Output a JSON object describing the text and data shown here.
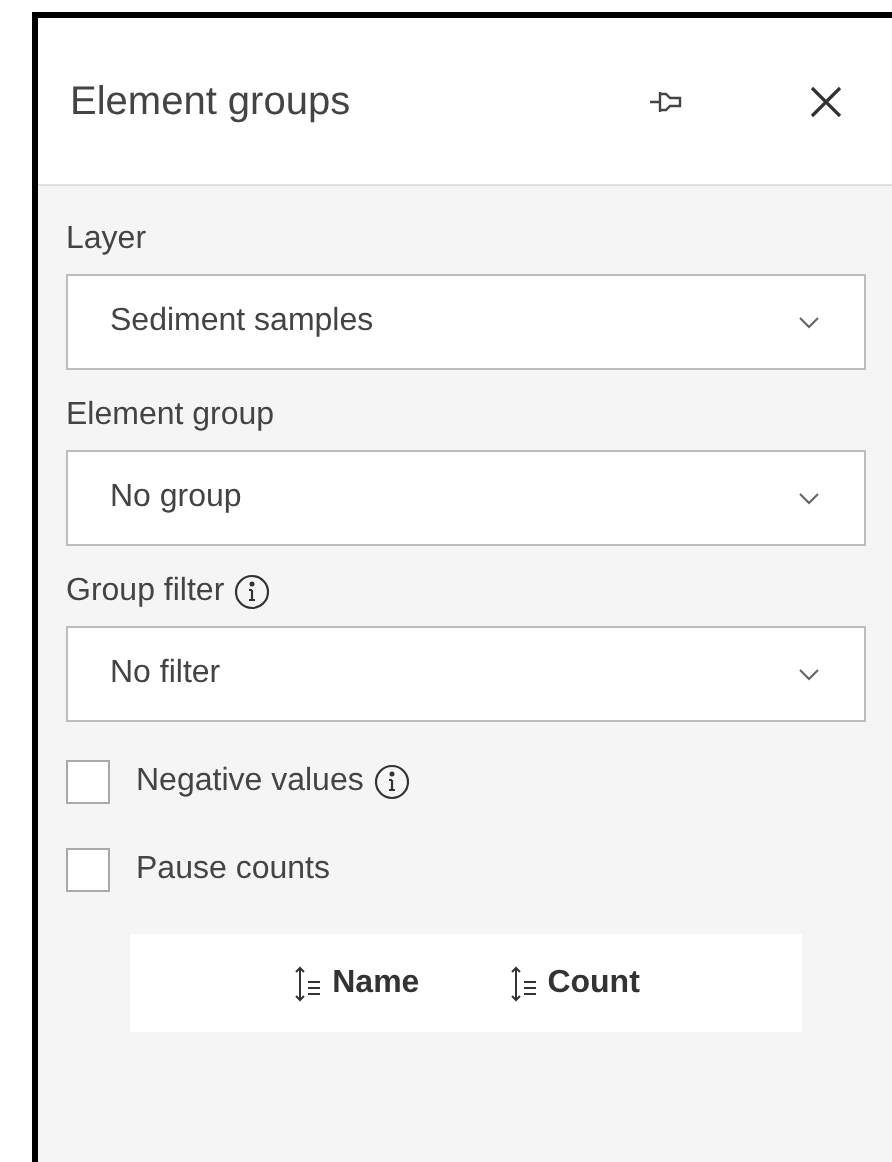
{
  "panel": {
    "title": "Element groups"
  },
  "fields": [
    {
      "label": "Layer",
      "value": "Sediment samples",
      "kind": "plain"
    },
    {
      "label": "Element group",
      "value": "No group",
      "kind": "plain"
    },
    {
      "label": "Group filter",
      "value": "No filter",
      "kind": "info"
    }
  ],
  "options": [
    {
      "label": "Negative values",
      "checked": false,
      "kind": "info"
    },
    {
      "label": "Pause counts",
      "checked": false,
      "kind": "plain"
    }
  ],
  "sort_columns": [
    {
      "label": "Name"
    },
    {
      "label": "Count"
    }
  ]
}
